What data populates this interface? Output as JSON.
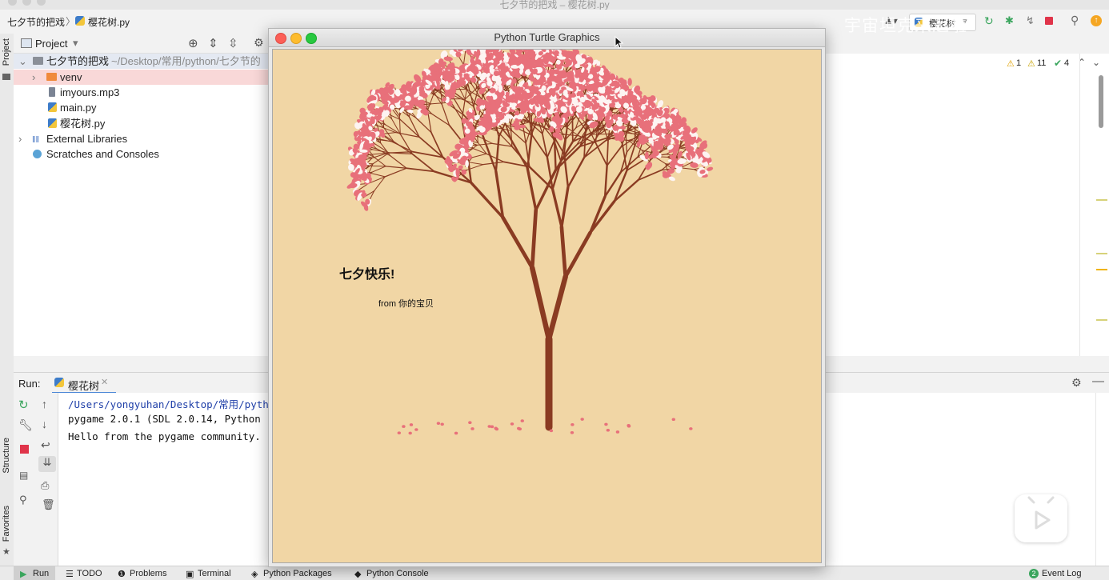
{
  "ide": {
    "window_title": "七夕节的把戏 – 樱花树.py",
    "breadcrumb_project": "七夕节的把戏",
    "breadcrumb_file": "樱花树.py",
    "run_config": "樱花树",
    "watermark": "宇宙坦克来迟啦"
  },
  "project_panel": {
    "title": "Project",
    "root_name": "七夕节的把戏",
    "root_path": "~/Desktop/常用/python/七夕节的",
    "items": [
      {
        "label": "venv"
      },
      {
        "label": "imyours.mp3"
      },
      {
        "label": "main.py"
      },
      {
        "label": "樱花树.py"
      },
      {
        "label": "External Libraries"
      },
      {
        "label": "Scratches and Consoles"
      }
    ]
  },
  "editor": {
    "warn_count": "1",
    "weak_warn_count": "11",
    "ok_count": "4"
  },
  "run_panel": {
    "label": "Run:",
    "tab": "樱花树",
    "console": [
      "/Users/yongyuhan/Desktop/常用/pyth",
      "pygame 2.0.1 (SDL 2.0.14, Python",
      "Hello from the pygame community."
    ]
  },
  "side_labels": {
    "project": "Project",
    "structure": "Structure",
    "favorites": "Favorites"
  },
  "bottom_tabs": [
    "Run",
    "TODO",
    "Problems",
    "Terminal",
    "Python Packages",
    "Python Console"
  ],
  "event_log": "Event Log",
  "event_log_count": "2",
  "turtle_window": {
    "title": "Python Turtle Graphics",
    "greeting": "七夕快乐!",
    "from_text": "from 你的宝贝"
  },
  "colors": {
    "canvas_bg": "#f1d6a5",
    "trunk": "#8a3b22",
    "petal_pink": "#e8707a",
    "petal_white": "#fdf4f2"
  },
  "icons": [
    "gear-icon",
    "target-icon",
    "expand-icon",
    "collapse-icon",
    "rerun-icon",
    "stop-icon",
    "wrench-icon",
    "print-icon",
    "trash-icon",
    "pin-icon",
    "arrow-up-icon",
    "arrow-down-icon",
    "play-icon"
  ]
}
